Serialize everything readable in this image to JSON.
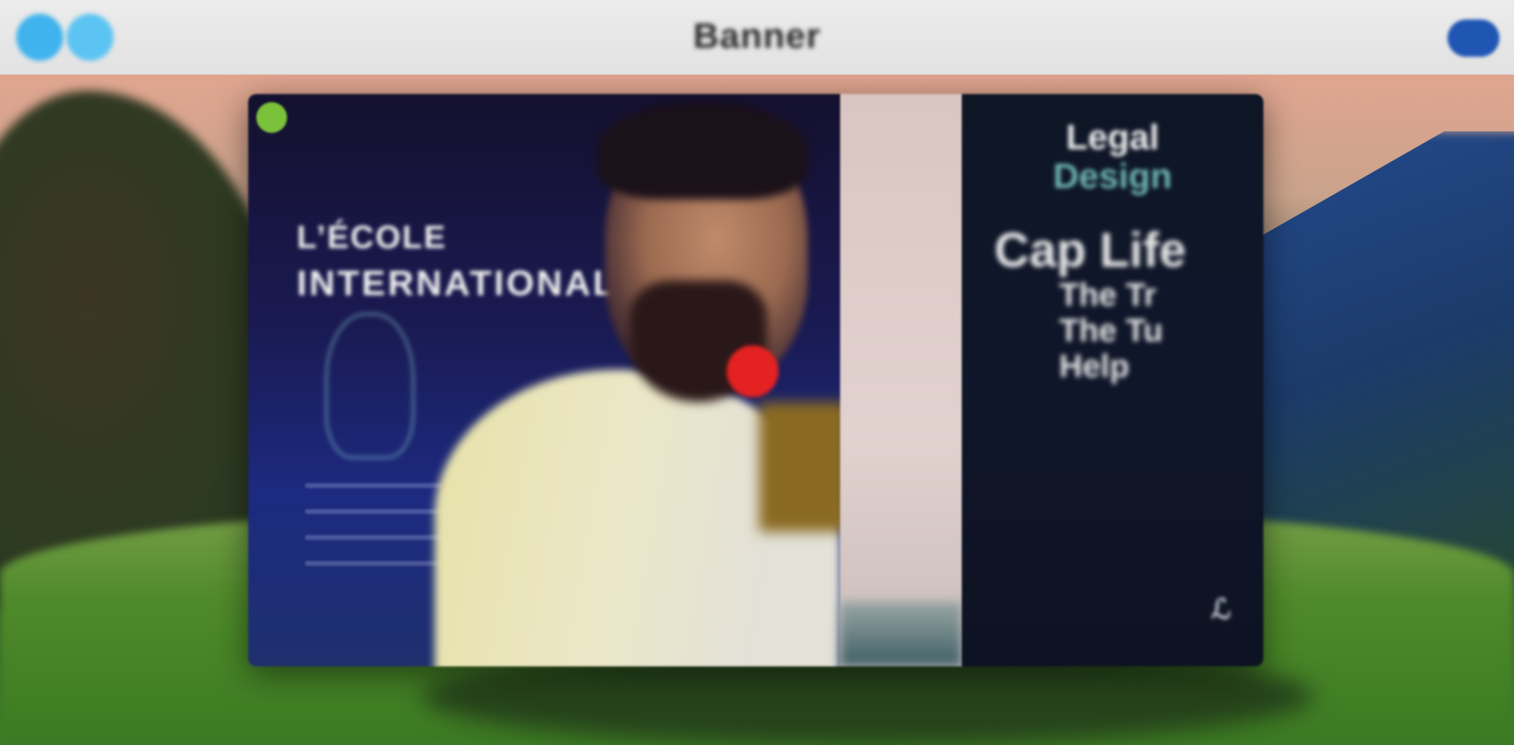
{
  "window": {
    "title": "Banner",
    "left_buttons": [
      "circle-icon",
      "circle-icon"
    ],
    "right_button": "pill-icon"
  },
  "colors": {
    "topbar": "#e6e6e6",
    "accent_blue": "#3fb3ee",
    "pill_blue": "#1f56b4",
    "logo_green": "#79c23a",
    "ball_red": "#e52222"
  },
  "card": {
    "left": {
      "headline_line1": "L’ÉCOLE",
      "headline_line2": "INTERNATIONALE"
    },
    "right": {
      "title_line1": "Legal",
      "title_line2": "Design",
      "script_lines": [
        "Cap Life",
        "The Tr",
        "The Tu",
        "Help"
      ]
    }
  }
}
